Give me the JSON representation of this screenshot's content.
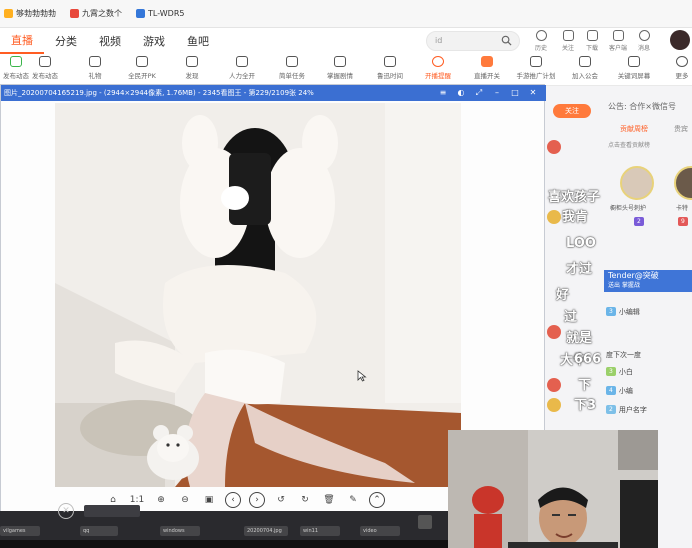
{
  "bookmarks": [
    {
      "label": "够勃勃勃勃",
      "color": "#ffb020"
    },
    {
      "label": "九霄之数个",
      "color": "#e8483b"
    },
    {
      "label": "TL-WDR5",
      "color": "#3477d9"
    }
  ],
  "nav": {
    "items": [
      "直播",
      "分类",
      "视频",
      "游戏",
      "鱼吧"
    ],
    "search_placeholder": "id",
    "top_icons": [
      "历史",
      "关注",
      "下载",
      "客户端",
      "消息"
    ]
  },
  "toolbar": {
    "items": [
      "发布动态",
      "礼物",
      "全民开PK",
      "发现",
      "人力全开",
      "简单任务",
      "掌握剧情",
      "鲁迅时间",
      "开播提醒",
      "直播开关",
      "手游推广计划",
      "加入公会",
      "关键词屏幕",
      "更多"
    ]
  },
  "viewer": {
    "title": "图片_20200704165219.jpg - (2944×2944像素, 1.76MB) - 2345看图王 - 第229/2109张 24%",
    "ratio_label": "1:1"
  },
  "right_panel": {
    "follow": "关注",
    "notice": "公告: 合作×微信号",
    "tabs": [
      "贡献周榜",
      "贵宾"
    ],
    "subtitle": "点击查看贡献榜",
    "tender_title": "Tender@突破",
    "tender_sub": "送出  掌握战",
    "danmu": [
      "喜欢孩子",
      "我肯",
      "LOO",
      "才过",
      "好",
      "过",
      "就是",
      "大牛",
      "666",
      "下",
      "下3"
    ],
    "chat": [
      {
        "user": "小编辑",
        "text": "",
        "badge": "#6bb5e8"
      },
      {
        "user": "",
        "text": "度下次一度",
        "badge": "#e8814b"
      },
      {
        "user": "小白",
        "text": "",
        "badge": "#9bd06a"
      },
      {
        "user": "小编",
        "text": "",
        "badge": "#6bb5e8"
      },
      {
        "user": "",
        "text": "用户名字",
        "badge": "#7ec0e8"
      }
    ],
    "rank": [
      {
        "name": "橱柜头号刺护",
        "level": "2",
        "color": "#7a5bd8"
      },
      {
        "name": "卡特",
        "level": "9",
        "color": "#e35858"
      }
    ]
  },
  "bottom": {
    "thumbs": [
      "vilgames",
      "qq",
      "windows",
      "20200704.jpg",
      "win11",
      "video"
    ]
  }
}
